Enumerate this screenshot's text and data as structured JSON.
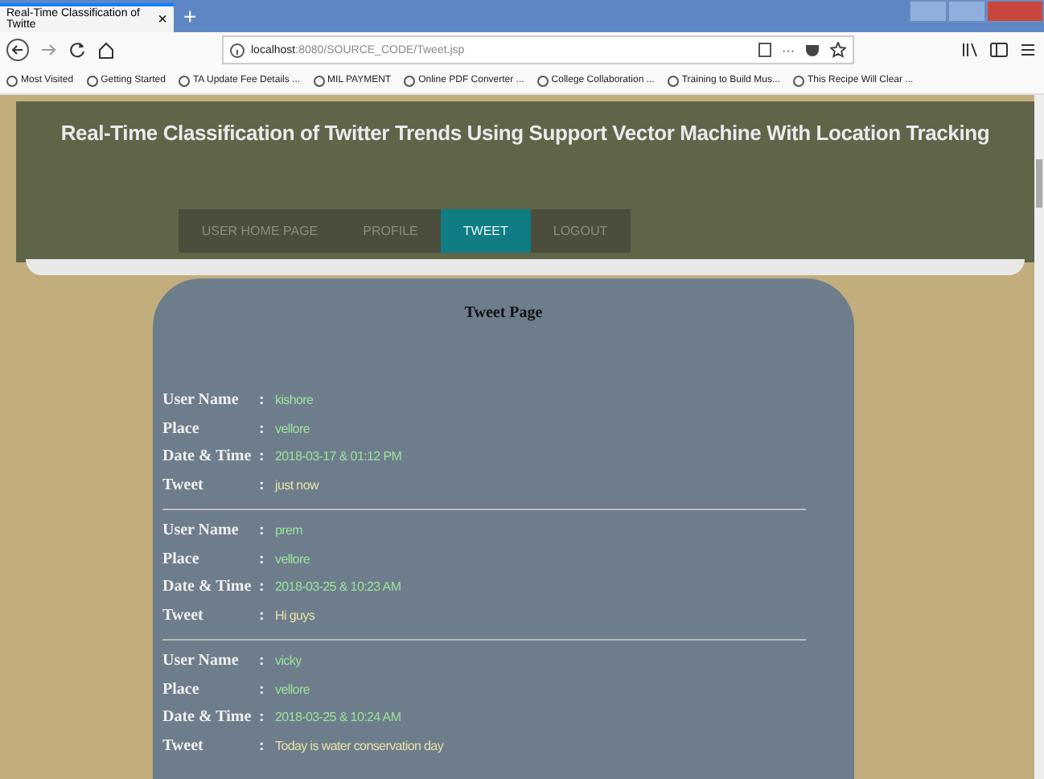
{
  "browser": {
    "tab": {
      "title": "Real-Time Classification of Twitte",
      "close": "×"
    },
    "new_tab": "+",
    "address": {
      "host": "localhost",
      "rest": ":8080/SOURCE_CODE/Tweet.jsp"
    },
    "more": "···",
    "bookmarks": [
      {
        "label": "Most Visited"
      },
      {
        "label": "Getting Started"
      },
      {
        "label": "TA Update Fee Details ..."
      },
      {
        "label": "MIL PAYMENT"
      },
      {
        "label": "Online PDF Converter ..."
      },
      {
        "label": "College Collaboration ..."
      },
      {
        "label": "Training to Build Mus..."
      },
      {
        "label": "This Recipe Will Clear ..."
      }
    ]
  },
  "header": {
    "title": "Real-Time Classification of Twitter Trends Using Support Vector Machine With Location Tracking"
  },
  "nav": [
    {
      "label": "USER HOME PAGE",
      "selected": false
    },
    {
      "label": "PROFILE",
      "selected": false
    },
    {
      "label": "TWEET",
      "selected": true
    },
    {
      "label": "LOGOUT",
      "selected": false
    }
  ],
  "card": {
    "title": "Tweet Page",
    "tweets": [
      {
        "fields": [
          {
            "label": "User Name",
            "sep": ":",
            "value": "kishore",
            "kind": "info"
          },
          {
            "label": "Place",
            "sep": ":",
            "value": "vellore",
            "kind": "info"
          },
          {
            "label": "Date & Time",
            "sep": ":",
            "value": "2018-03-17 & 01:12 PM",
            "kind": "info"
          },
          {
            "label": "Tweet",
            "sep": ":",
            "value": "just now",
            "kind": "message"
          }
        ]
      },
      {
        "fields": [
          {
            "label": "User Name",
            "sep": ":",
            "value": "prem",
            "kind": "info"
          },
          {
            "label": "Place",
            "sep": ":",
            "value": "vellore",
            "kind": "info"
          },
          {
            "label": "Date & Time",
            "sep": ":",
            "value": "2018-03-25 & 10:23 AM",
            "kind": "info"
          },
          {
            "label": "Tweet",
            "sep": ":",
            "value": "Hi guys",
            "kind": "message"
          }
        ]
      },
      {
        "fields": [
          {
            "label": "User Name",
            "sep": ":",
            "value": "vicky",
            "kind": "info"
          },
          {
            "label": "Place",
            "sep": ":",
            "value": "vellore",
            "kind": "info"
          },
          {
            "label": "Date & Time",
            "sep": ":",
            "value": "2018-03-25 & 10:24 AM",
            "kind": "info"
          },
          {
            "label": "Tweet",
            "sep": ":",
            "value": "Today is water conservation day",
            "kind": "message"
          }
        ]
      }
    ]
  }
}
